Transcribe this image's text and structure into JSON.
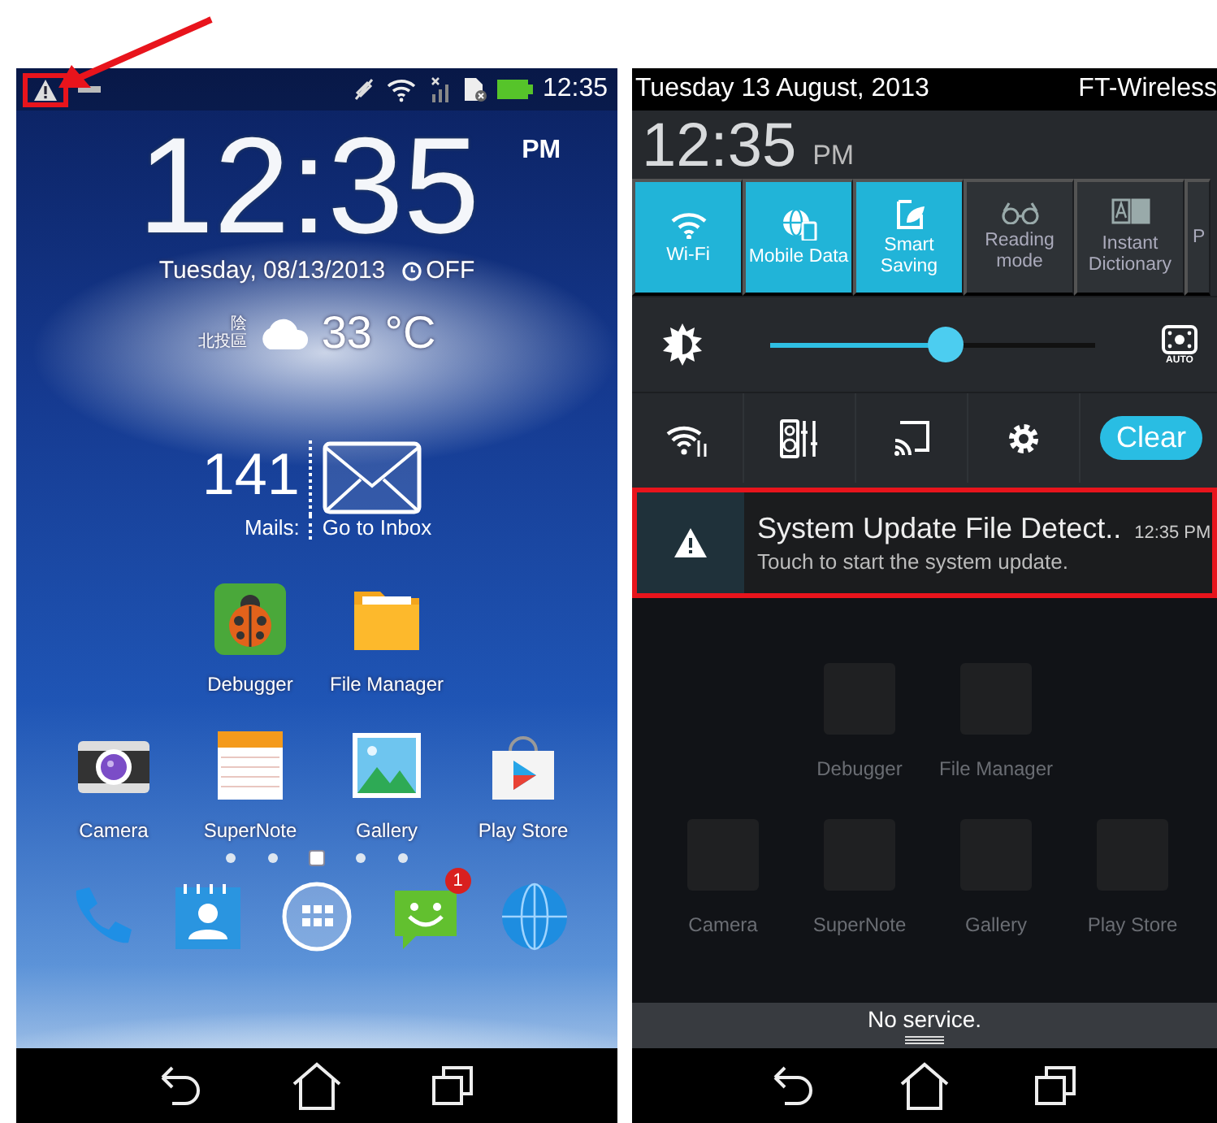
{
  "home": {
    "status_bar": {
      "warning_highlighted": true,
      "time": "12:35"
    },
    "clock": {
      "time": "12:35",
      "meridiem": "PM",
      "date": "Tuesday, 08/13/2013",
      "alarm": "OFF"
    },
    "weather": {
      "condition": "陰",
      "location": "北投區",
      "temperature": "33 °C"
    },
    "mail": {
      "count": "141",
      "count_label": "Mails:",
      "action": "Go to Inbox"
    },
    "app_rows": [
      [
        {
          "kind": "debugger",
          "label": "Debugger"
        },
        {
          "kind": "folder",
          "label": "File Manager"
        }
      ],
      [
        {
          "kind": "camera",
          "label": "Camera"
        },
        {
          "kind": "notes",
          "label": "SuperNote"
        },
        {
          "kind": "gallery",
          "label": "Gallery"
        },
        {
          "kind": "store",
          "label": "Play Store"
        }
      ]
    ],
    "page_dots": [
      {
        "selected": false
      },
      {
        "selected": false
      },
      {
        "selected": true
      },
      {
        "selected": false
      },
      {
        "selected": false
      }
    ],
    "dock": [
      {
        "kind": "phone"
      },
      {
        "kind": "contacts"
      },
      {
        "kind": "apps"
      },
      {
        "kind": "messages",
        "badge": "1"
      },
      {
        "kind": "browser"
      }
    ]
  },
  "shade": {
    "date": "Tuesday 13 August, 2013",
    "network": "FT-Wireless",
    "clock": {
      "time": "12:35",
      "meridiem": "PM"
    },
    "tiles": [
      {
        "kind": "wifi",
        "label": "Wi-Fi",
        "on": true
      },
      {
        "kind": "data",
        "label": "Mobile Data",
        "on": true
      },
      {
        "kind": "saving",
        "label": "Smart Saving",
        "on": true
      },
      {
        "kind": "reading",
        "label": "Reading mode",
        "on": false
      },
      {
        "kind": "dictionary",
        "label": "Instant Dictionary",
        "on": false
      },
      {
        "kind": "cut",
        "label": "P",
        "on": false
      }
    ],
    "brightness": {
      "level": 0.54,
      "auto_label": "AUTO"
    },
    "clear_label": "Clear",
    "notification": {
      "title": "System Update File Detect..",
      "time": "12:35 PM",
      "text": "Touch to start the system update.",
      "highlighted": true
    },
    "dimmed_apps": [
      [
        "Debugger",
        "File Manager"
      ],
      [
        "Camera",
        "SuperNote",
        "Gallery",
        "Play Store"
      ]
    ],
    "service": "No service."
  }
}
